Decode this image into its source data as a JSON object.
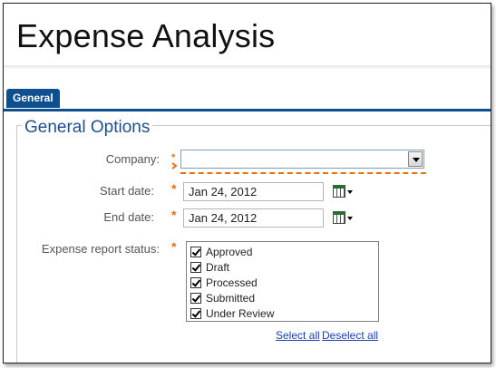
{
  "header": {
    "title": "Expense Analysis"
  },
  "tabs": [
    {
      "label": "General",
      "active": true
    }
  ],
  "section": {
    "legend": "General Options"
  },
  "form": {
    "company": {
      "label": "Company:",
      "value": "",
      "required": true,
      "error": true
    },
    "start_date": {
      "label": "Start date:",
      "value": "Jan 24, 2012",
      "required": true
    },
    "end_date": {
      "label": "End date:",
      "value": "Jan 24, 2012",
      "required": true
    },
    "status": {
      "label": "Expense report status:",
      "required": true,
      "options": [
        {
          "label": "Approved",
          "checked": true
        },
        {
          "label": "Draft",
          "checked": true
        },
        {
          "label": "Processed",
          "checked": true
        },
        {
          "label": "Submitted",
          "checked": true
        },
        {
          "label": "Under Review",
          "checked": true
        }
      ],
      "select_all": "Select all",
      "deselect_all": "Deselect all"
    }
  },
  "required_marker": "*",
  "colors": {
    "accent": "#0e4f8f",
    "legend": "#1d4f8f",
    "required": "#e8700e",
    "link": "#1a3fb0"
  },
  "icons": {
    "calendar": "calendar-icon",
    "dropdown": "chevron-down-icon"
  }
}
